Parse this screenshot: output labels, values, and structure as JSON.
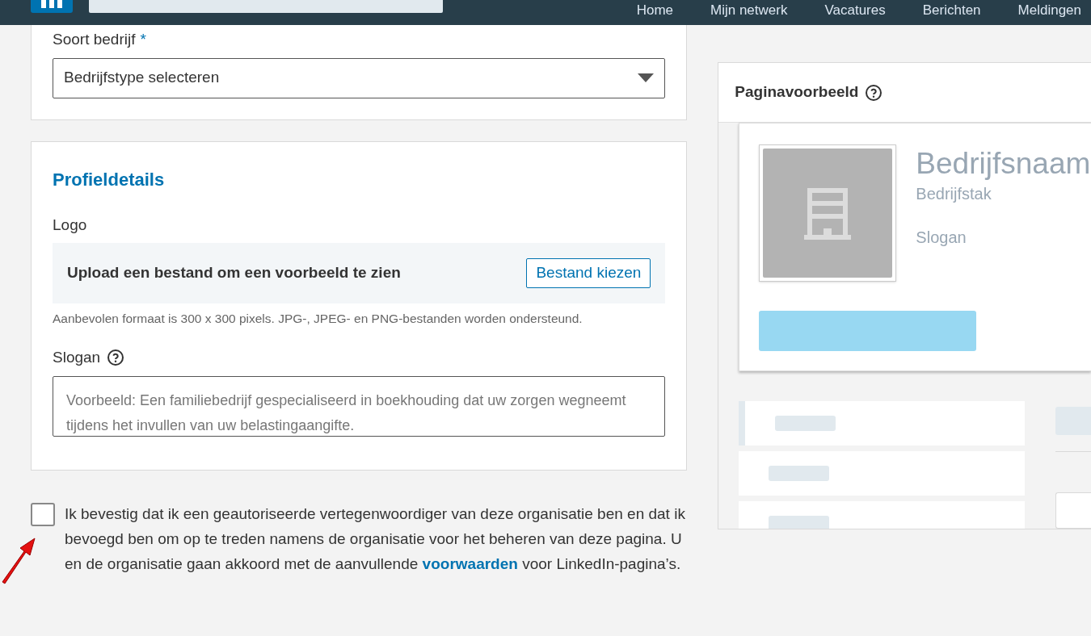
{
  "nav": {
    "items": [
      {
        "label": "Home",
        "selected": false
      },
      {
        "label": "Mijn netwerk",
        "selected": false
      },
      {
        "label": "Vacatures",
        "selected": false
      },
      {
        "label": "Berichten",
        "selected": false
      },
      {
        "label": "Meldingen",
        "selected": false
      }
    ]
  },
  "company_type": {
    "label": "Soort bedrijf",
    "required_mark": "*",
    "value": "Bedrijfstype selecteren"
  },
  "profile": {
    "title": "Profieldetails",
    "logo_label": "Logo",
    "upload_text": "Upload een bestand om een voorbeeld te zien",
    "upload_button": "Bestand kiezen",
    "logo_hint": "Aanbevolen formaat is 300 x 300 pixels. JPG-, JPEG- en PNG-bestanden worden ondersteund.",
    "slogan_label": "Slogan",
    "slogan_placeholder": "Voorbeeld: Een familiebedrijf gespecialiseerd in boekhouding dat uw zorgen wegneemt tijdens het invullen van uw belastingaangifte."
  },
  "consent": {
    "checked": false,
    "text_before": "Ik bevestig dat ik een geautoriseerde vertegenwoordiger van deze organisatie ben en dat ik bevoegd ben om op te treden namens de organisatie voor het beheren van deze pagina. U en de organisatie gaan akkoord met de aanvullende ",
    "link": "voorwaarden",
    "text_after": " voor LinkedIn-pagina’s."
  },
  "preview": {
    "title": "Paginavoorbeeld",
    "name": "Bedrijfsnaam",
    "industry": "Bedrijfstak",
    "slogan": "Slogan"
  }
}
